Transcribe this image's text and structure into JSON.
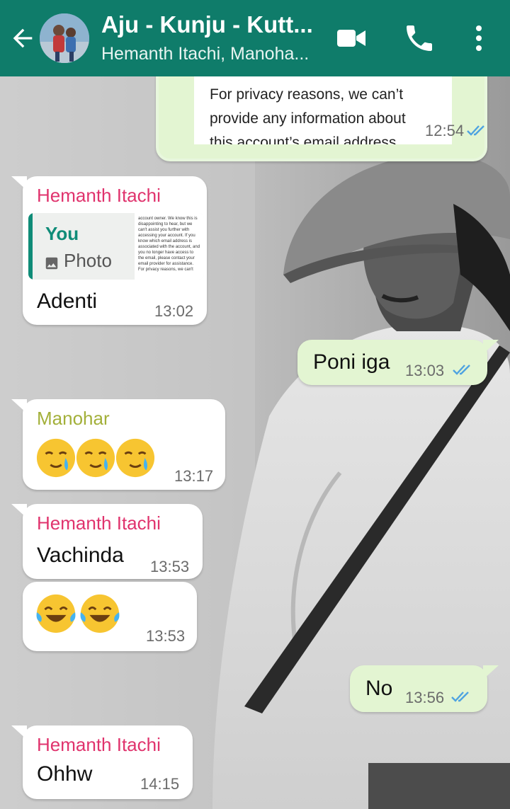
{
  "header": {
    "title": "Aju - Kunju - Kutt...",
    "subtitle": "Hemanth Itachi, Manoha...",
    "accent": "#0f7c6a"
  },
  "messages": [
    {
      "direction": "out",
      "text": "For privacy reasons, we can't provide any information about this account's email address.",
      "line1": "For privacy reasons, we can’t",
      "line2": "provide any information about",
      "line3": "this account’s email address.",
      "time": "12:54",
      "status": "read"
    },
    {
      "direction": "in",
      "sender": "Hemanth Itachi",
      "sender_color": "#e0336d",
      "reply": {
        "name": "You",
        "type_label": "Photo",
        "thumb_text": "account owner. We know this is disappointing to hear, but we can't assist you further with accessing your account. If you know which email address is associated with the account, and you no longer have access to the email, please contact your email provider for assistance. For privacy reasons, we can't"
      },
      "text": "Adenti",
      "time": "13:02"
    },
    {
      "direction": "out",
      "text": "Poni iga",
      "time": "13:03",
      "status": "read"
    },
    {
      "direction": "in",
      "sender": "Manohar",
      "sender_color": "#a3b03a",
      "emojis": [
        "crying-smile",
        "crying-smile",
        "crying-smile"
      ],
      "time": "13:17"
    },
    {
      "direction": "in",
      "sender": "Hemanth Itachi",
      "sender_color": "#e0336d",
      "text": "Vachinda",
      "time": "13:53"
    },
    {
      "direction": "in",
      "emojis": [
        "tears-of-joy",
        "tears-of-joy"
      ],
      "time": "13:53"
    },
    {
      "direction": "out",
      "text": "No",
      "time": "13:56",
      "status": "read"
    },
    {
      "direction": "in",
      "sender": "Hemanth Itachi",
      "sender_color": "#e0336d",
      "text": "Ohhw",
      "time": "14:15"
    }
  ],
  "colors": {
    "incoming_bubble": "#ffffff",
    "outgoing_bubble": "#e3f5d2",
    "read_ticks": "#4fa3e0"
  }
}
